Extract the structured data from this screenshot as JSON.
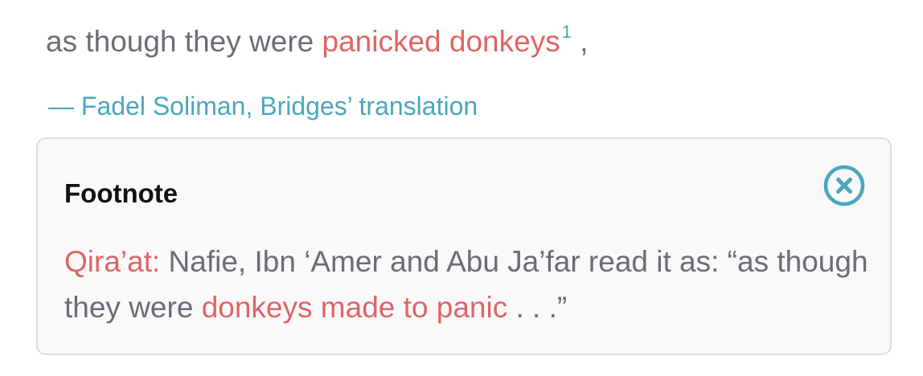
{
  "verse": {
    "prefix": "as though they were ",
    "highlight": "panicked donkeys",
    "footnote_ref": "1",
    "suffix": " ,"
  },
  "attribution": "— Fadel Soliman, Bridges’ translation",
  "footnote": {
    "title": "Footnote",
    "close_icon": "close-circle-icon",
    "label": "Qira’at:",
    "text_before": " Nafie, Ibn ‘Amer and Abu Ja’far read it as: “as though they were ",
    "highlight": "donkeys made to panic",
    "text_after": " . . .”"
  },
  "colors": {
    "body_text": "#6c6c77",
    "highlight": "#e06464",
    "accent": "#4aa7bd",
    "panel_bg": "#f9f9f9",
    "panel_border": "#dcdcdc"
  }
}
